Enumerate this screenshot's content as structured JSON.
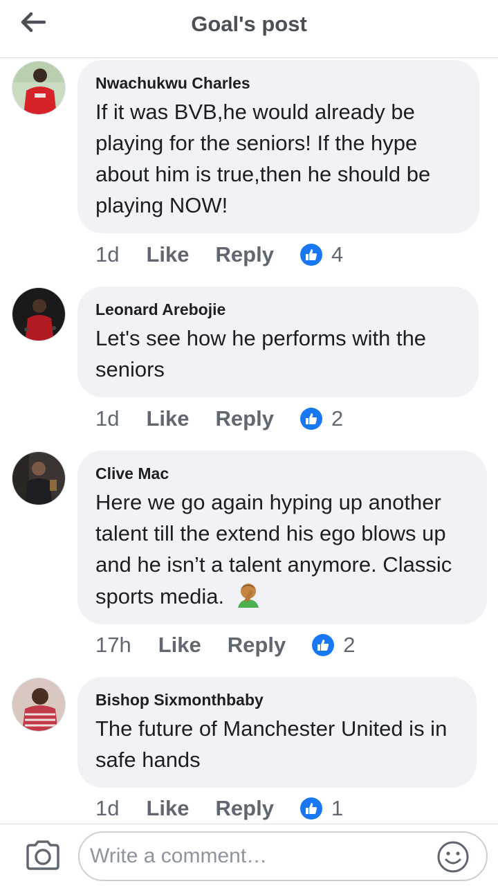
{
  "header": {
    "title": "Goal's post"
  },
  "comments": [
    {
      "author": "Nwachukwu Charles",
      "text": "If it was BVB,he would already be playing for the seniors! If the hype about him is true,then he should be playing NOW!",
      "time": "1d",
      "like": "Like",
      "reply": "Reply",
      "reactions": "4"
    },
    {
      "author": "Leonard Arebojie",
      "text": "Let's see how he performs with the seniors",
      "time": "1d",
      "like": "Like",
      "reply": "Reply",
      "reactions": "2"
    },
    {
      "author": "Clive Mac",
      "text": "Here we go again hyping up another talent till the extend his ego blows up and he isn’t a talent anymore. Classic sports media.",
      "time": "17h",
      "like": "Like",
      "reply": "Reply",
      "reactions": "2"
    },
    {
      "author": "Bishop Sixmonthbaby",
      "text": "The future of Manchester United is in safe hands",
      "time": "1d",
      "like": "Like",
      "reply": "Reply",
      "reactions": "1"
    }
  ],
  "composer": {
    "placeholder": "Write a comment…"
  },
  "icons": {
    "back": "arrow-left-icon",
    "like": "thumbs-up-icon",
    "camera": "camera-icon",
    "emoji": "smiley-icon",
    "facepalm": "facepalm-emoji"
  },
  "colors": {
    "like_blue": "#1877f2",
    "bubble": "#f0f2f5",
    "muted": "#606770"
  }
}
